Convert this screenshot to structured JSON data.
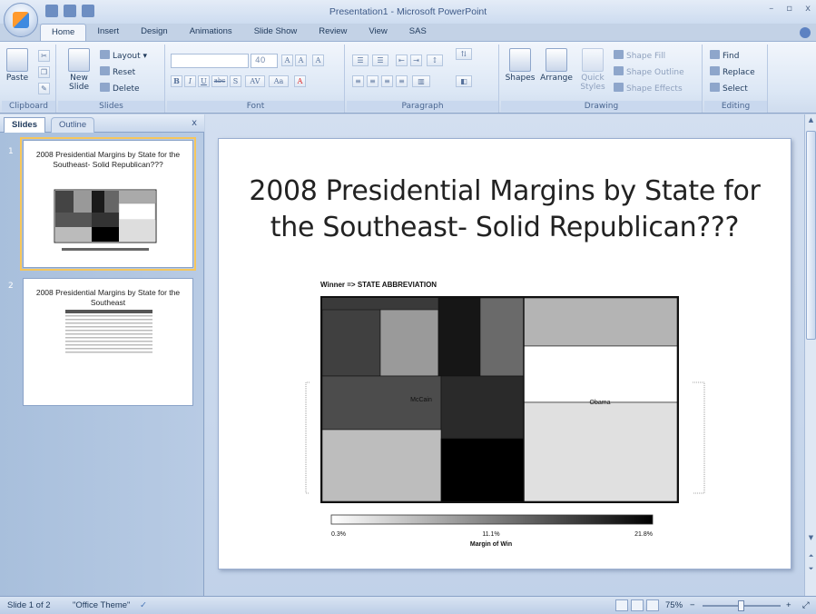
{
  "window": {
    "title": "Presentation1 - Microsoft PowerPoint",
    "controls": [
      "–",
      "▫",
      "x"
    ]
  },
  "tabs": [
    "Home",
    "Insert",
    "Design",
    "Animations",
    "Slide Show",
    "Review",
    "View",
    "SAS"
  ],
  "active_tab": "Home",
  "ribbon": {
    "clipboard": {
      "label": "Clipboard",
      "paste": "Paste"
    },
    "slides": {
      "label": "Slides",
      "new_slide_1": "New",
      "new_slide_2": "Slide",
      "layout": "Layout",
      "reset": "Reset",
      "delete": "Delete"
    },
    "font": {
      "label": "Font",
      "size": "40",
      "grow": "A",
      "shrink": "A",
      "clear": "A",
      "bold": "B",
      "italic": "I",
      "underline": "U",
      "strike": "abc",
      "shadow": "S",
      "spacing": "AV",
      "case": "Aa",
      "color": "A"
    },
    "paragraph": {
      "label": "Paragraph"
    },
    "drawing": {
      "label": "Drawing",
      "shapes": "Shapes",
      "arrange": "Arrange",
      "quick_styles_1": "Quick",
      "quick_styles_2": "Styles",
      "shape_fill": "Shape Fill",
      "shape_outline": "Shape Outline",
      "shape_effects": "Shape Effects"
    },
    "editing": {
      "label": "Editing",
      "find": "Find",
      "replace": "Replace",
      "select": "Select"
    }
  },
  "left_pane": {
    "tab_slides": "Slides",
    "tab_outline": "Outline",
    "close": "x",
    "thumbnails": [
      {
        "number": "1",
        "title": "2008 Presidential Margins by State for the Southeast- Solid Republican???"
      },
      {
        "number": "2",
        "title": "2008 Presidential Margins by State for the Southeast"
      }
    ]
  },
  "slide": {
    "title_line1": "2008 Presidential Margins by State for",
    "title_line2": "the Southeast- Solid Republican???",
    "chart_header": "Winner => STATE ABBREVIATION",
    "label_mccain": "McCain",
    "label_obama": "Obama",
    "legend_min": "0.3%",
    "legend_mid": "11.1%",
    "legend_max": "21.8%",
    "legend_title": "Margin of Win"
  },
  "chart_data": {
    "type": "treemap",
    "title": "Winner => STATE ABBREVIATION",
    "color_scale": {
      "label": "Margin of Win",
      "min": "0.3%",
      "mid": "11.1%",
      "max": "21.8%",
      "low_color": "#ffffff",
      "high_color": "#000000"
    },
    "groups": [
      {
        "name": "McCain",
        "tiles": [
          {
            "shade": 0.78
          },
          {
            "shade": 0.42
          },
          {
            "shade": 0.92
          },
          {
            "shade": 0.6
          },
          {
            "shade": 0.75
          },
          {
            "shade": 0.84
          },
          {
            "shade": 0.26
          },
          {
            "shade": 1.0
          }
        ]
      },
      {
        "name": "Obama",
        "tiles": [
          {
            "shade": 0.28
          },
          {
            "shade": 0.0
          },
          {
            "shade": 0.12
          }
        ]
      }
    ]
  },
  "statusbar": {
    "slide_count": "Slide 1 of 2",
    "theme": "\"Office Theme\"",
    "zoom": "75%",
    "zoom_out": "−",
    "zoom_in": "+"
  }
}
